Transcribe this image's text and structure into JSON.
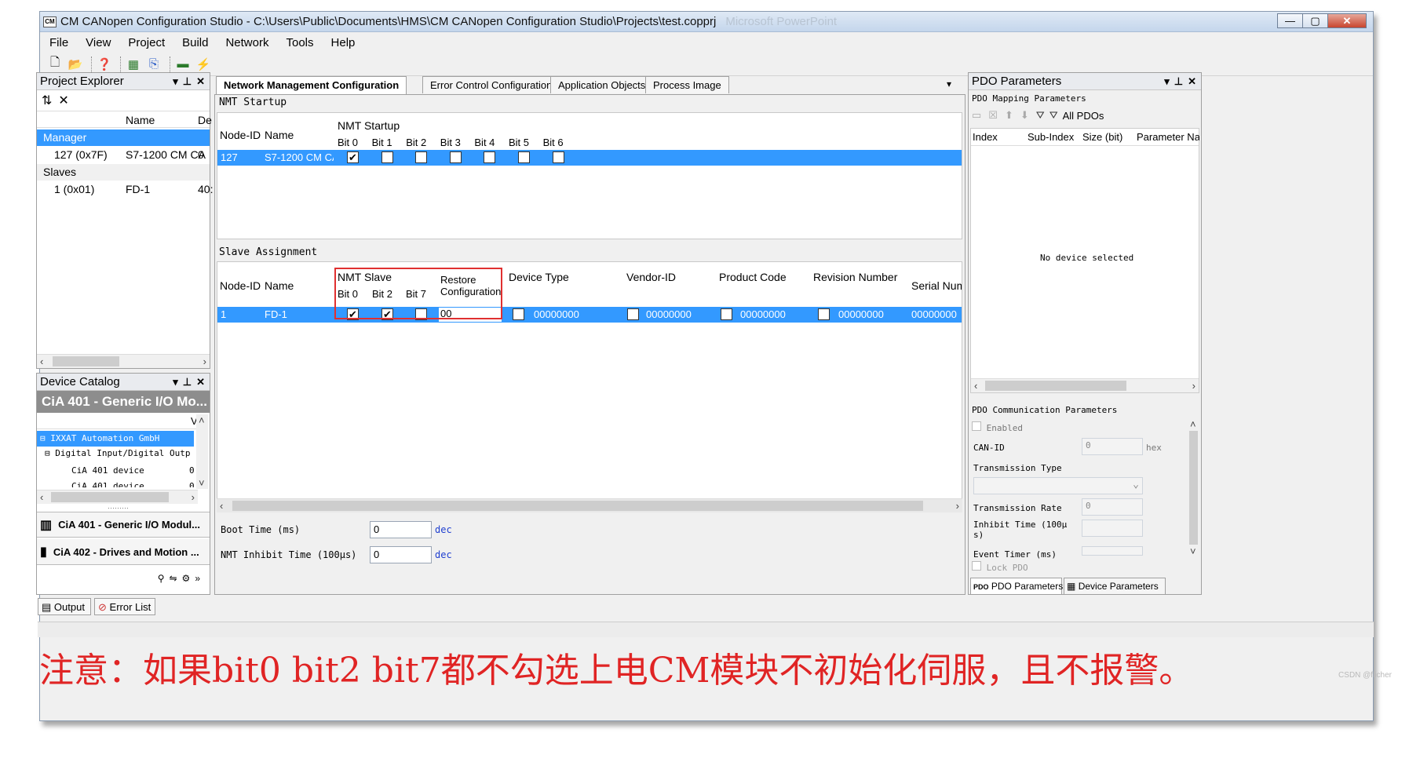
{
  "window": {
    "title": "CM CANopen Configuration Studio - C:\\Users\\Public\\Documents\\HMS\\CM CANopen Configuration Studio\\Projects\\test.copprj",
    "title_faded": "Microsoft PowerPoint",
    "app_icon": "CM",
    "minimize": "—",
    "maximize": "▢",
    "close": "✕"
  },
  "menu": [
    "File",
    "View",
    "Project",
    "Build",
    "Network",
    "Tools",
    "Help"
  ],
  "project_explorer": {
    "title": "Project Explorer",
    "columns": [
      "Name",
      "De"
    ],
    "manager_label": "Manager",
    "manager_row": {
      "id": "127 (0x7F)",
      "name": "S7-1200 CM CA",
      "de": "0"
    },
    "slaves_label": "Slaves",
    "slave_row": {
      "id": "1 (0x01)",
      "name": "FD-1",
      "de": "40:"
    }
  },
  "device_catalog": {
    "title": "Device Catalog",
    "banner": "CiA 401 - Generic I/O Mo...",
    "col_v": "V",
    "tree": [
      "IXXAT Automation GmbH",
      "Digital Input/Digital Outp",
      "CiA 401 device",
      "CiA 401 device"
    ],
    "tree_values": [
      "0",
      "0"
    ],
    "groups": [
      "CiA 401 - Generic I/O Modul...",
      "CiA 402 - Drives and Motion ..."
    ],
    "grip": "·········"
  },
  "tabs": [
    "Network Management Configuration",
    "Error Control Configuration",
    "Application Objects",
    "Process Image"
  ],
  "nmt_startup": {
    "section": "NMT Startup",
    "group_header": "NMT Startup",
    "col_node": "Node-ID",
    "col_name": "Name",
    "bits": [
      "Bit 0",
      "Bit 1",
      "Bit 2",
      "Bit 3",
      "Bit 4",
      "Bit 5",
      "Bit 6"
    ],
    "row": {
      "node": "127",
      "name": "S7-1200 CM CA",
      "bits_checked": [
        true,
        false,
        false,
        false,
        false,
        false,
        false
      ]
    }
  },
  "slave_assignment": {
    "section": "Slave Assignment",
    "col_node": "Node-ID",
    "col_name": "Name",
    "nmt_slave": "NMT Slave",
    "bits": [
      "Bit 0",
      "Bit 2",
      "Bit 7"
    ],
    "restore": "Restore Configuration",
    "device_type": "Device Type",
    "vendor_id": "Vendor-ID",
    "product_code": "Product Code",
    "revision": "Revision Number",
    "serial": "Serial Numb",
    "row": {
      "node": "1",
      "name": "FD-1",
      "bits_checked": [
        true,
        true,
        false
      ],
      "restore": "00",
      "device_type": "00000000",
      "vendor_id": "00000000",
      "product_code": "00000000",
      "revision": "00000000",
      "serial": "00000000"
    }
  },
  "bottom_params": {
    "boot_label": "Boot Time (ms)",
    "boot_value": "0",
    "boot_unit": "dec",
    "inhibit_label": "NMT Inhibit Time (100µs)",
    "inhibit_value": "0",
    "inhibit_unit": "dec"
  },
  "pdo": {
    "title": "PDO Parameters",
    "mapping_label": "PDO Mapping Parameters",
    "all_pdos": "All PDOs",
    "columns": [
      "Index",
      "Sub-Index",
      "Size (bit)",
      "Parameter Nam"
    ],
    "empty_msg": "No device selected",
    "comm_label": "PDO Communication Parameters",
    "enabled": "Enabled",
    "can_id": "CAN-ID",
    "can_id_value": "0",
    "hex": "hex",
    "trans_type": "Transmission Type",
    "trans_rate": "Transmission Rate",
    "trans_rate_value": "0",
    "inhibit_time": "Inhibit Time (100µ s)",
    "event_timer": "Event Timer (ms)",
    "lock_pdo": "Lock PDO",
    "bottom_tabs": [
      "PDO Parameters",
      "Device Parameters"
    ]
  },
  "bottom_tabs": [
    "Output",
    "Error List"
  ],
  "note": "注意：如果bit0 bit2 bit7都不勾选上电CM模块不初始化伺服，且不报警。",
  "watermark": "CSDN @flicher"
}
